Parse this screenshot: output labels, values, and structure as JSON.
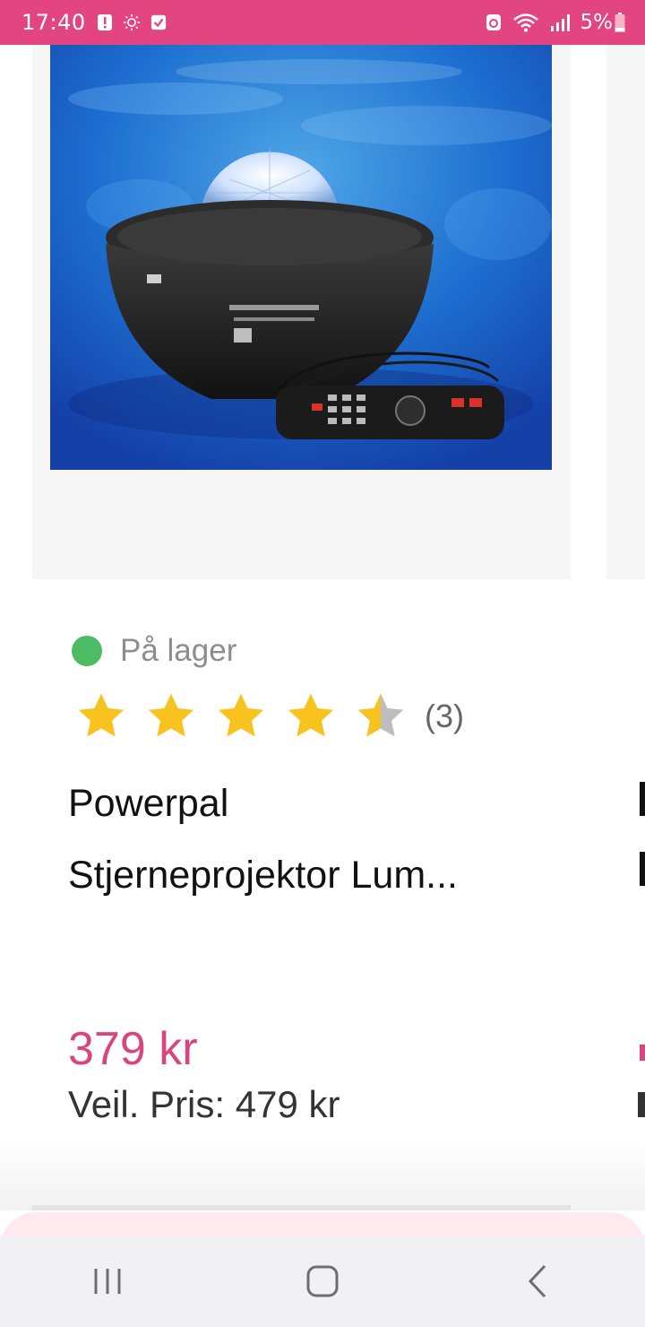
{
  "status_bar": {
    "time": "17:40",
    "battery_percent": "5%",
    "icons": [
      "alert-icon",
      "sun-icon",
      "check-box-icon",
      "battery-saver-icon",
      "wifi-icon",
      "signal-icon",
      "battery-icon"
    ]
  },
  "product": {
    "image_alt": "Star projector with remote control",
    "stock_label": "På lager",
    "rating_value": 4.5,
    "rating_max": 5,
    "rating_count": "(3)",
    "title_line1": "Powerpal",
    "title_line2": "Stjerneprojektor Lum...",
    "price": "379 kr",
    "rrp": "Veil. Pris: 479 kr"
  },
  "nav_bar": {
    "icons": [
      "recent-apps-icon",
      "home-icon",
      "back-icon"
    ]
  },
  "colors": {
    "status_bar": "#e2457f",
    "price": "#d9457f",
    "stock_dot": "#4dbb63",
    "star": "#f8c31f",
    "star_empty": "#bdbdbd"
  }
}
